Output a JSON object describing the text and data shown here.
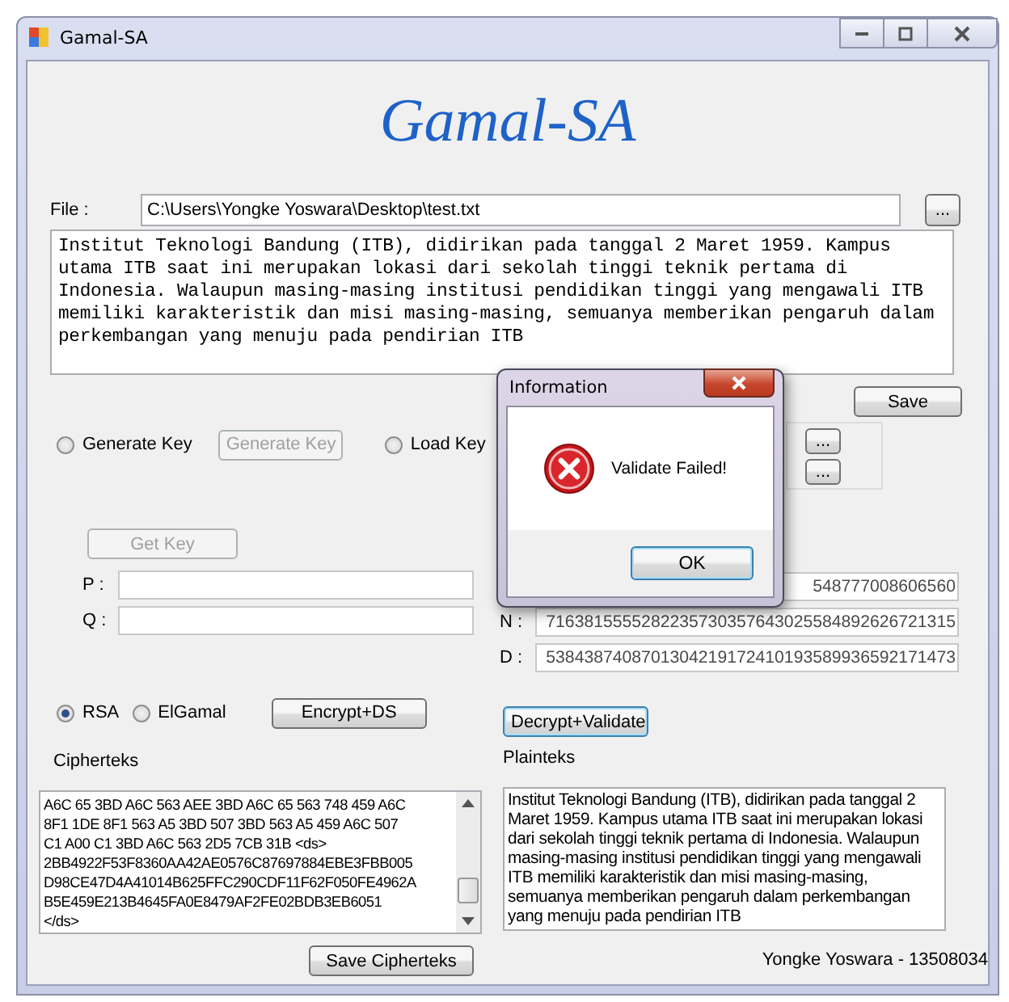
{
  "window": {
    "title": "Gamal-SA"
  },
  "app_title": "Gamal-SA",
  "file": {
    "label": "File :",
    "value": "C:\\Users\\Yongke Yoswara\\Desktop\\test.txt",
    "browse_button": "..."
  },
  "input_text": "Institut Teknologi Bandung (ITB), didirikan pada tanggal 2 Maret 1959. Kampus utama ITB saat ini merupakan lokasi dari sekolah tinggi teknik pertama di Indonesia. Walaupun masing-masing institusi pendidikan tinggi yang mengawali ITB memiliki karakteristik dan misi masing-masing, semuanya memberikan pengaruh dalam perkembangan yang menuju pada pendirian ITB",
  "save_button": "Save",
  "key_options": [
    {
      "label": "Generate Key",
      "selected": false
    },
    {
      "label": "Load Key",
      "selected": false
    }
  ],
  "generate_key_button": {
    "label": "Generate Key",
    "disabled": true
  },
  "load_key_buttons": [
    "...",
    "..."
  ],
  "get_key_button": {
    "label": "Get Key",
    "disabled": true
  },
  "left_key_fields": [
    {
      "label": "P :"
    },
    {
      "label": "Q :"
    }
  ],
  "right_key_fields": [
    {
      "value": "548777008606560"
    },
    {
      "label": "N :",
      "value": "7163815555282235730357643025584892626721315"
    },
    {
      "label": "D :",
      "value": "5384387408701304219172410193589936592171473"
    }
  ],
  "algorithms": [
    {
      "label": "RSA",
      "selected": true
    },
    {
      "label": "ElGamal",
      "selected": false
    }
  ],
  "encrypt_button": "Encrypt+DS",
  "decrypt_button": "Decrypt+Validate",
  "cipher": {
    "label": "Cipherteks",
    "text": "A6C 65 3BD A6C 563 AEE 3BD A6C 65 563 748 459 A6C\n8F1 1DE 8F1 563 A5 3BD 507 3BD 563 A5 459 A6C 507\nC1 A00 C1 3BD A6C 563 2D5 7CB 31B <ds>\n2BB4922F53F8360AA42AE0576C87697884EBE3FBB005\nD98CE47D4A41014B625FFC290CDF11F62F050FE4962A\nB5E459E213B4645FA0E8479AF2FE02BDB3EB6051\n</ds>"
  },
  "plain": {
    "label": "Plainteks",
    "text": "Institut Teknologi Bandung (ITB), didirikan pada tanggal 2 Maret 1959. Kampus utama ITB saat ini merupakan lokasi dari sekolah tinggi teknik pertama di Indonesia. Walaupun masing-masing institusi pendidikan tinggi yang mengawali ITB memiliki karakteristik dan misi masing-masing, semuanya memberikan pengaruh dalam perkembangan yang menuju pada pendirian ITB"
  },
  "save_cipher_button": "Save Cipherteks",
  "author": "Yongke Yoswara - 13508034",
  "dialog": {
    "title": "Information",
    "message": "Validate Failed!",
    "ok_button": "OK"
  }
}
